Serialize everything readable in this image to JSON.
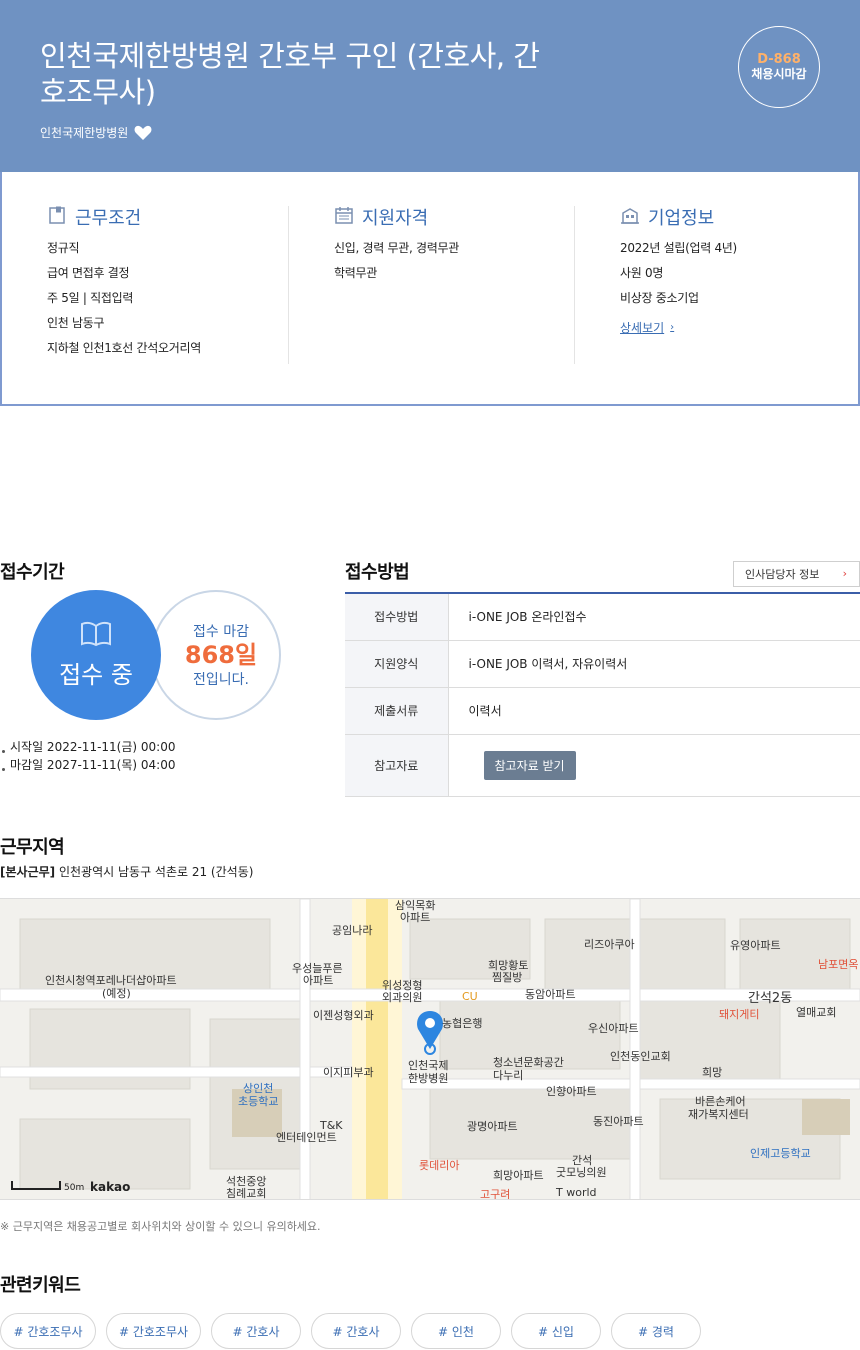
{
  "header": {
    "title": "인천국제한방병원 간호부 구인 (간호사, 간호조무사)",
    "company": "인천국제한방병원",
    "dday": {
      "count": "D-868",
      "label": "채용시마감"
    }
  },
  "summary": {
    "work": {
      "title": "근무조건",
      "items": [
        "정규직",
        "급여 면접후 결정",
        "주 5일 | 직접입력",
        "인천 남동구",
        "지하철 인천1호선 간석오거리역"
      ]
    },
    "qualification": {
      "title": "지원자격",
      "items": [
        "신입, 경력 무관, 경력무관",
        "학력무관"
      ]
    },
    "company": {
      "title": "기업정보",
      "items": [
        "2022년 설립(업력 4년)",
        "사원 0명",
        "비상장 중소기업"
      ],
      "detail_link": "상세보기"
    }
  },
  "period": {
    "title": "접수기간",
    "status": "접수 중",
    "deadline_label": "접수 마감",
    "deadline_days": "868일",
    "deadline_suffix": "전입니다.",
    "start": "시작일 2022-11-11(금) 00:00",
    "end": "마감일 2027-11-11(목) 04:00"
  },
  "method": {
    "title": "접수방법",
    "hr_button": "인사담당자 정보",
    "rows": [
      {
        "label": "접수방법",
        "value": "i-ONE JOB 온라인접수"
      },
      {
        "label": "지원양식",
        "value": "i-ONE JOB 이력서, 자유이력서"
      },
      {
        "label": "제출서류",
        "value": "이력서"
      },
      {
        "label": "참고자료",
        "button": "참고자료 받기"
      }
    ]
  },
  "location": {
    "title": "근무지역",
    "tag": "[본사근무]",
    "address": "인천광역시 남동구 석촌로 21 (간석동)",
    "note": "※ 근무지역은 채용공고별로 회사위치와 상이할 수 있으니 유의하세요.",
    "map": {
      "scale": "50m",
      "brand": "kakao",
      "labels": [
        "삼익목화",
        "아파트",
        "공임나라",
        "인천시청역포레나더샵아파트",
        "(예정)",
        "우성늘푸른",
        "아파트",
        "위성정형",
        "외과의원",
        "CU",
        "희망황토",
        "찜질방",
        "동암아파트",
        "리즈아쿠아",
        "유영아파트",
        "남포면옥",
        "간석2동",
        "돼지게티",
        "열매교회",
        "이젠성형외과",
        "농협은행",
        "우신아파트",
        "인천동인교회",
        "희망",
        "이지피부과",
        "인천국제",
        "한방병원",
        "청소년문화공간",
        "다누리",
        "상인천",
        "초등학교",
        "인향아파트",
        "바른손케어",
        "재가복지센터",
        "T&K",
        "엔터테인먼트",
        "광명아파트",
        "동진아파트",
        "인제고등학교",
        "롯데리아",
        "희망아파트",
        "간석",
        "굿모닝의원",
        "석천중앙",
        "침례교회",
        "고구려",
        "T world"
      ]
    }
  },
  "keywords": {
    "title": "관련키워드",
    "items": [
      "# 간호조무사",
      "# 간호조무사",
      "# 간호사",
      "# 간호사",
      "# 인천",
      "# 신입",
      "# 경력"
    ]
  },
  "colors": {
    "hero": "#6f92c2",
    "accent": "#3a6db3",
    "status_circle": "#3f87e0",
    "deadline": "#ef6c3c"
  },
  "icons": [
    "heart-icon",
    "work-conditions-icon",
    "calendar-icon",
    "building-icon",
    "book-icon",
    "chevron-right-icon",
    "map-pin-icon"
  ]
}
